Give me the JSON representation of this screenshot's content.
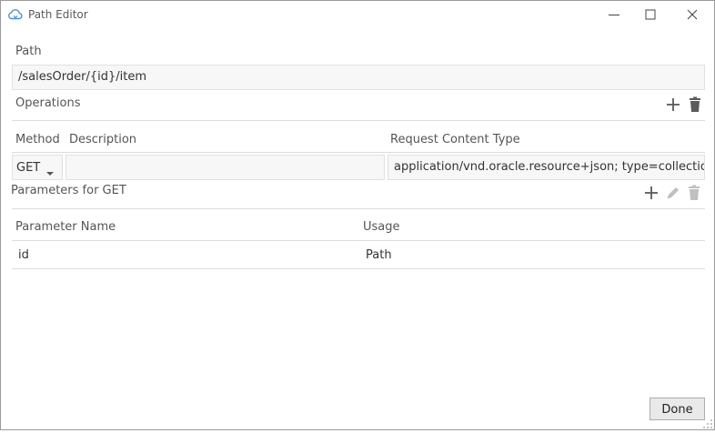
{
  "window": {
    "title": "Path Editor",
    "controls": [
      "minimize",
      "maximize",
      "close"
    ]
  },
  "path": {
    "label": "Path",
    "value": "/salesOrder/{id}/item"
  },
  "operations": {
    "label": "Operations",
    "columns": {
      "method": "Method",
      "description": "Description",
      "request_content_type": "Request Content Type"
    },
    "row": {
      "method": "GET",
      "description": "",
      "request_content_type": "application/vnd.oracle.resource+json; type=collection"
    }
  },
  "parameters": {
    "label": "Parameters for GET",
    "columns": {
      "name": "Parameter Name",
      "usage": "Usage"
    },
    "rows": [
      {
        "name": "id",
        "usage": "Path"
      }
    ]
  },
  "footer": {
    "done_label": "Done"
  },
  "colors": {
    "icon": "#5a5a5a",
    "icon_disabled": "#c0c0c0",
    "app_icon": "#4a8fd6",
    "field_bg": "#f7f7f7",
    "divider": "#dcdcdc"
  }
}
